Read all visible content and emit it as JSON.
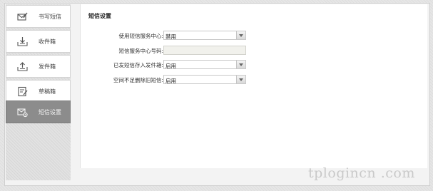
{
  "sidebar": {
    "items": [
      {
        "label": "书写短信",
        "icon": "compose-sms-icon",
        "active": false
      },
      {
        "label": "收件箱",
        "icon": "inbox-icon",
        "active": false
      },
      {
        "label": "发件箱",
        "icon": "outbox-icon",
        "active": false
      },
      {
        "label": "草稿箱",
        "icon": "drafts-icon",
        "active": false
      },
      {
        "label": "短信设置",
        "icon": "sms-settings-icon",
        "active": true
      }
    ]
  },
  "main": {
    "title": "短信设置",
    "fields": [
      {
        "label": "使用短信服务中心:",
        "type": "select",
        "value": "禁用"
      },
      {
        "label": "短信服务中心号码:",
        "type": "text",
        "value": ""
      },
      {
        "label": "已发短信存入发件箱:",
        "type": "select",
        "value": "启用"
      },
      {
        "label": "空间不足删除旧短信:",
        "type": "select",
        "value": "启用"
      }
    ]
  },
  "watermark": "tplogincn .com",
  "colors": {
    "active_nav_bg": "#8c8c8c",
    "panel_bg": "#ffffff",
    "page_bg": "#e6e6e6"
  }
}
